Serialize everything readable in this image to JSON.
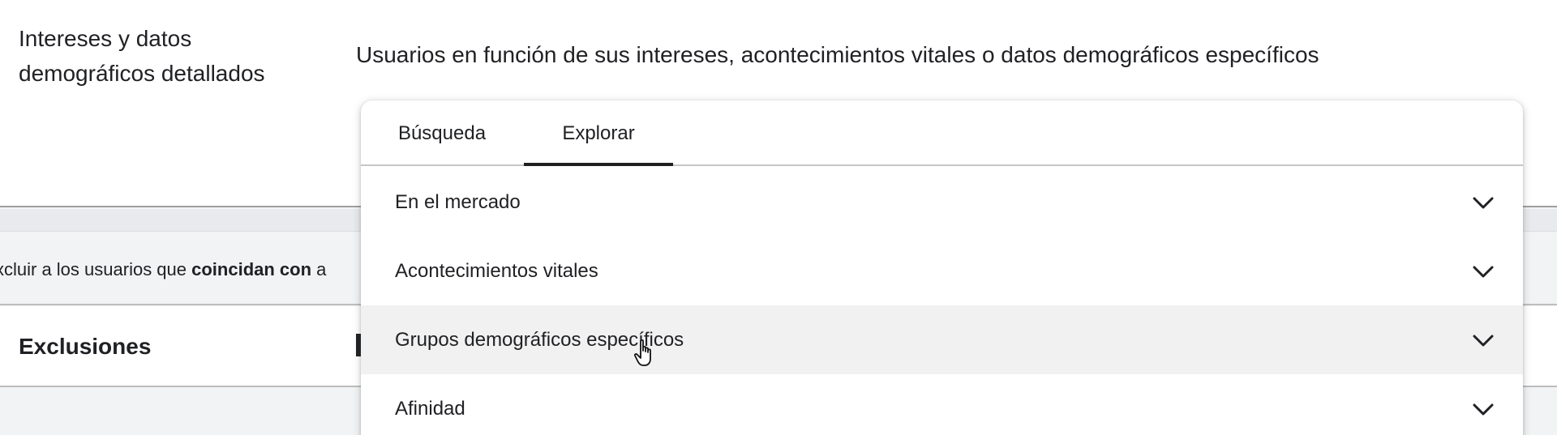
{
  "criterion": {
    "label": "Intereses y datos demográficos detallados",
    "description": "Usuarios en función de sus intereses, acontecimientos vitales o datos demográficos específicos"
  },
  "exclusion_notice": {
    "prefix": "xcluir a los usuarios que ",
    "bold": "coincidan con ",
    "trailing": "a"
  },
  "exclusions": {
    "label": "Exclusiones",
    "cut_text": "I"
  },
  "panel": {
    "tabs": [
      {
        "label": "Búsqueda",
        "active": false
      },
      {
        "label": "Explorar",
        "active": true
      }
    ],
    "items": [
      {
        "label": "En el mercado",
        "icon": "chevron-down-icon"
      },
      {
        "label": "Acontecimientos vitales",
        "icon": "chevron-down-icon"
      },
      {
        "label": "Grupos demográficos específicos",
        "icon": "chevron-down-icon",
        "hovered": true
      },
      {
        "label": "Afinidad",
        "icon": "chevron-down-icon"
      }
    ]
  },
  "colors": {
    "text": "#202124",
    "grey_background": "#f1f3f4",
    "hover_row": "#f1f1f1",
    "tab_indicator": "#1f1f1f"
  }
}
